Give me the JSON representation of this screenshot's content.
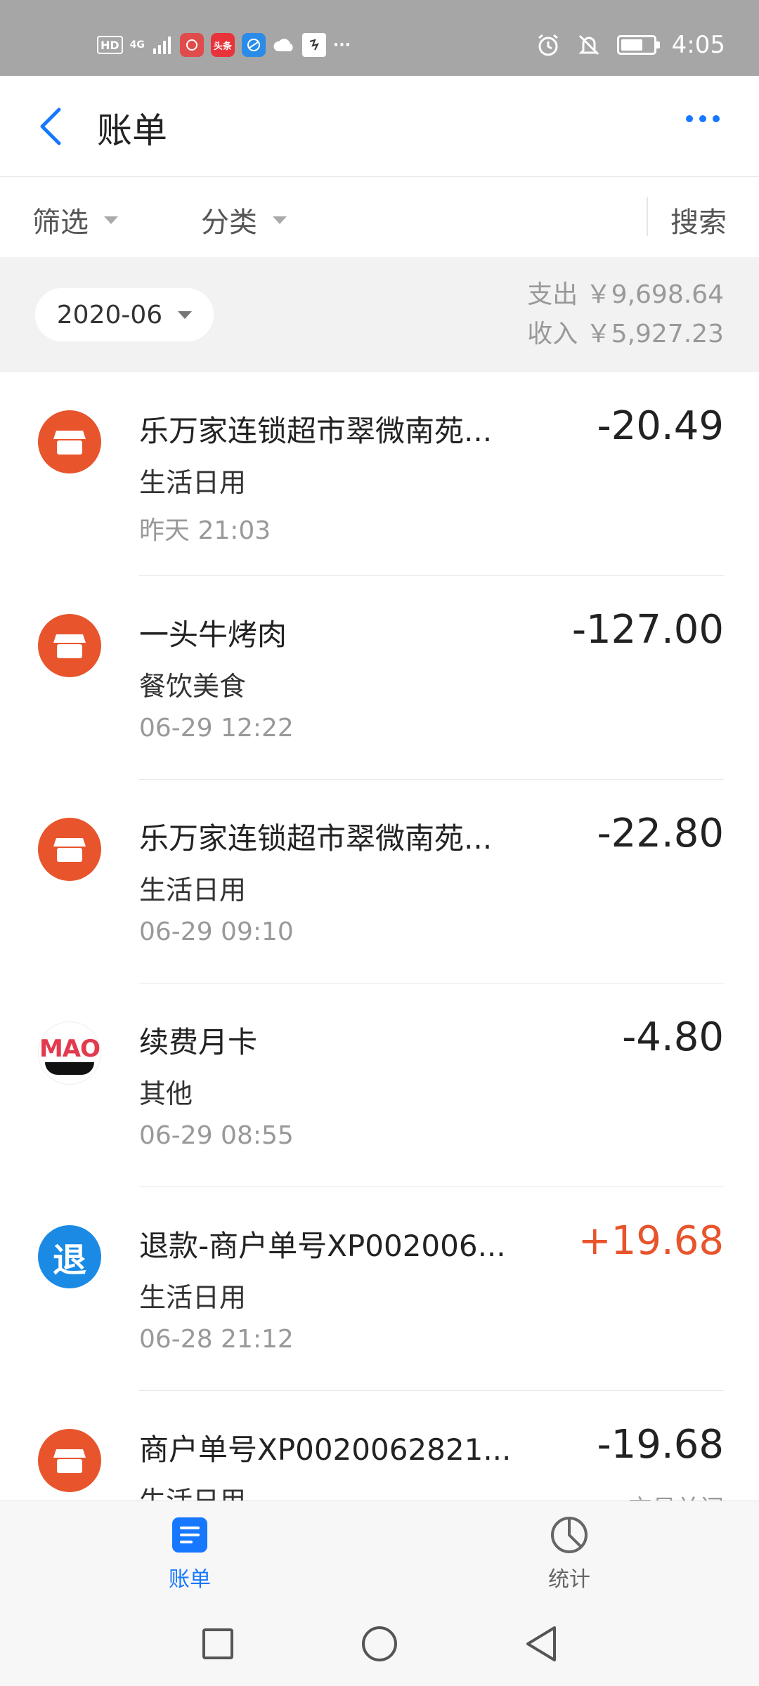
{
  "status_bar": {
    "hd": "HD",
    "network": "4G",
    "app_badge": "头条",
    "more": "···",
    "time": "4:05",
    "battery_level": 0.7,
    "icons": [
      "signal-icon",
      "huawei-icon",
      "toutiao-icon",
      "browser-icon",
      "cloud-icon",
      "app-icon",
      "alarm-icon",
      "mute-icon",
      "battery-icon"
    ]
  },
  "header": {
    "title": "账单",
    "back_icon": "chevron-left-icon",
    "more_icon": "more-dots-icon"
  },
  "filter_bar": {
    "filter_label": "筛选",
    "category_label": "分类",
    "search_label": "搜索"
  },
  "summary": {
    "month": "2020-06",
    "expense": "支出 ￥9,698.64",
    "income": "收入 ￥5,927.23"
  },
  "transactions": [
    {
      "icon": "store-icon",
      "name": "乐万家连锁超市翠微南苑...",
      "category": "生活日用",
      "time": "昨天  21:03",
      "amount": "-20.49",
      "status": ""
    },
    {
      "icon": "store-icon",
      "name": "一头牛烤肉",
      "category": "餐饮美食",
      "time": "06-29  12:22",
      "amount": "-127.00",
      "status": ""
    },
    {
      "icon": "store-icon",
      "name": "乐万家连锁超市翠微南苑...",
      "category": "生活日用",
      "time": "06-29  09:10",
      "amount": "-22.80",
      "status": ""
    },
    {
      "icon": "maoyan-logo",
      "logo_text": "MAO",
      "name": "续费月卡",
      "category": "其他",
      "time": "06-29  08:55",
      "amount": "-4.80",
      "status": ""
    },
    {
      "icon": "refund-icon",
      "icon_text": "退",
      "name": "退款-商户单号XP002006...",
      "category": "生活日用",
      "time": "06-28  21:12",
      "amount": "+19.68",
      "status": ""
    },
    {
      "icon": "store-icon",
      "name": "商户单号XP0020062821...",
      "category": "生活日用",
      "time": "",
      "amount": "-19.68",
      "status": "交易关闭"
    }
  ],
  "tab_bar": {
    "bill_label": "账单",
    "stats_label": "统计"
  },
  "colors": {
    "accent": "#1677ff",
    "store": "#e8542c",
    "refund": "#1a8ae5",
    "income_amount": "#e8542c"
  }
}
